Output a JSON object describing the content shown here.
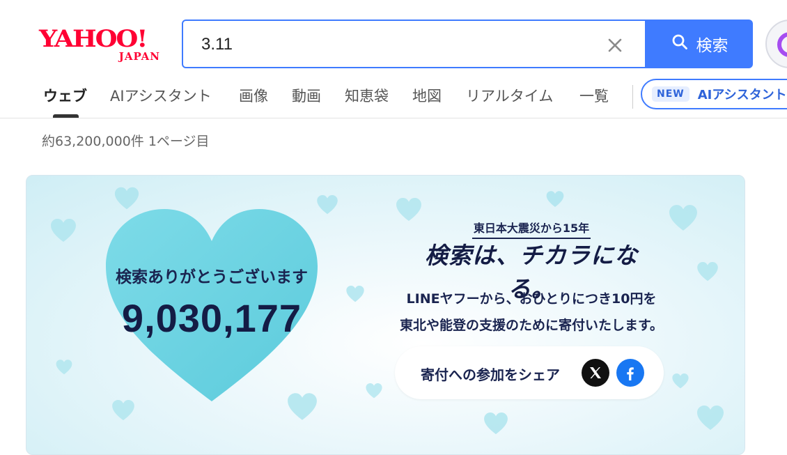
{
  "logo": {
    "main": "YAHOO!",
    "sub": "JAPAN"
  },
  "search": {
    "query": "3.11",
    "button_label": "検索"
  },
  "tabs": [
    {
      "label": "ウェブ"
    },
    {
      "label": "AIアシスタント"
    },
    {
      "label": "画像"
    },
    {
      "label": "動画"
    },
    {
      "label": "知恵袋"
    },
    {
      "label": "地図"
    },
    {
      "label": "リアルタイム"
    },
    {
      "label": "一覧"
    }
  ],
  "ai_promo": {
    "badge": "NEW",
    "label": "AIアシスタント"
  },
  "results": {
    "count_text": "約63,200,000件 1ページ目"
  },
  "banner": {
    "thanks": "検索ありがとうございます",
    "counter": "9,030,177",
    "anniversary": "東日本大震災から15年",
    "slogan": "検索は、チカラになる。",
    "description_line1": "LINEヤフーから、おひとりにつき10円を",
    "description_line2": "東北や能登の支援のために寄付いたします。",
    "share_label": "寄付への参加をシェア"
  },
  "colors": {
    "brand_red": "#ff0033",
    "accent_blue": "#3f7bff",
    "heart_blue": "#6dd3e2",
    "navy": "#141c45",
    "facebook_blue": "#1877f2"
  },
  "icons": {
    "search": "search-icon",
    "clear": "close-icon",
    "x": "x-logo-icon",
    "facebook": "facebook-icon"
  }
}
